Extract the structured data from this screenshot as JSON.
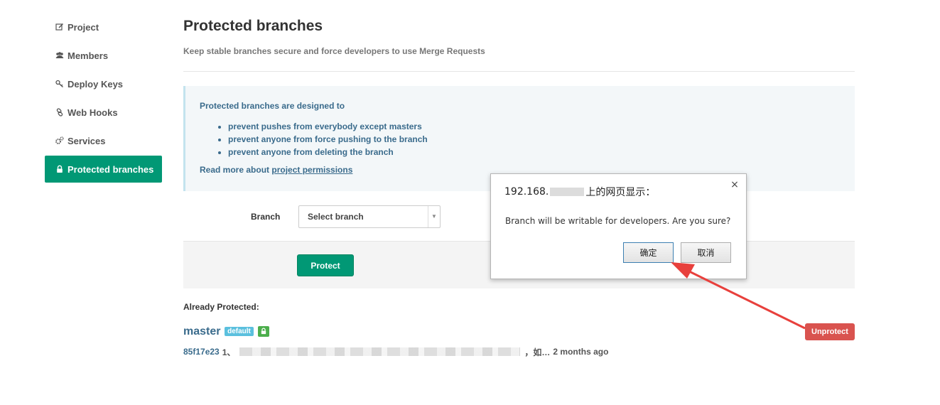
{
  "sidebar": {
    "items": [
      {
        "label": "Project",
        "icon": "edit-icon"
      },
      {
        "label": "Members",
        "icon": "users-icon"
      },
      {
        "label": "Deploy Keys",
        "icon": "key-icon"
      },
      {
        "label": "Web Hooks",
        "icon": "link-icon"
      },
      {
        "label": "Services",
        "icon": "cogs-icon"
      },
      {
        "label": "Protected branches",
        "icon": "lock-icon",
        "active": true
      }
    ]
  },
  "main": {
    "title": "Protected branches",
    "subtitle": "Keep stable branches secure and force developers to use Merge Requests",
    "info": {
      "lead": "Protected branches are designed to",
      "bullets": [
        "prevent pushes from everybody except masters",
        "prevent anyone from force pushing to the branch",
        "prevent anyone from deleting the branch"
      ],
      "more_prefix": "Read more about",
      "more_link": "project permissions"
    },
    "form": {
      "branch_label": "Branch",
      "select_value": "Select branch",
      "protect_label": "Protect"
    },
    "already_protected_label": "Already Protected:",
    "protected": {
      "name": "master",
      "default_badge": "default",
      "unprotect_label": "Unprotect",
      "commit_sha": "85f17e23",
      "commit_prefix": "1、",
      "commit_suffix": "，如…",
      "commit_time": "2 months ago"
    }
  },
  "dialog": {
    "title_prefix": "192.168.",
    "title_suffix": "上的网页显示：",
    "close": "×",
    "message": "Branch will be writable for developers. Are you sure?",
    "ok_label": "确定",
    "cancel_label": "取消"
  },
  "colors": {
    "accent": "#019875",
    "danger": "#d9534f",
    "info_text": "#3a6b8c",
    "annotation_arrow": "#e8403c"
  }
}
